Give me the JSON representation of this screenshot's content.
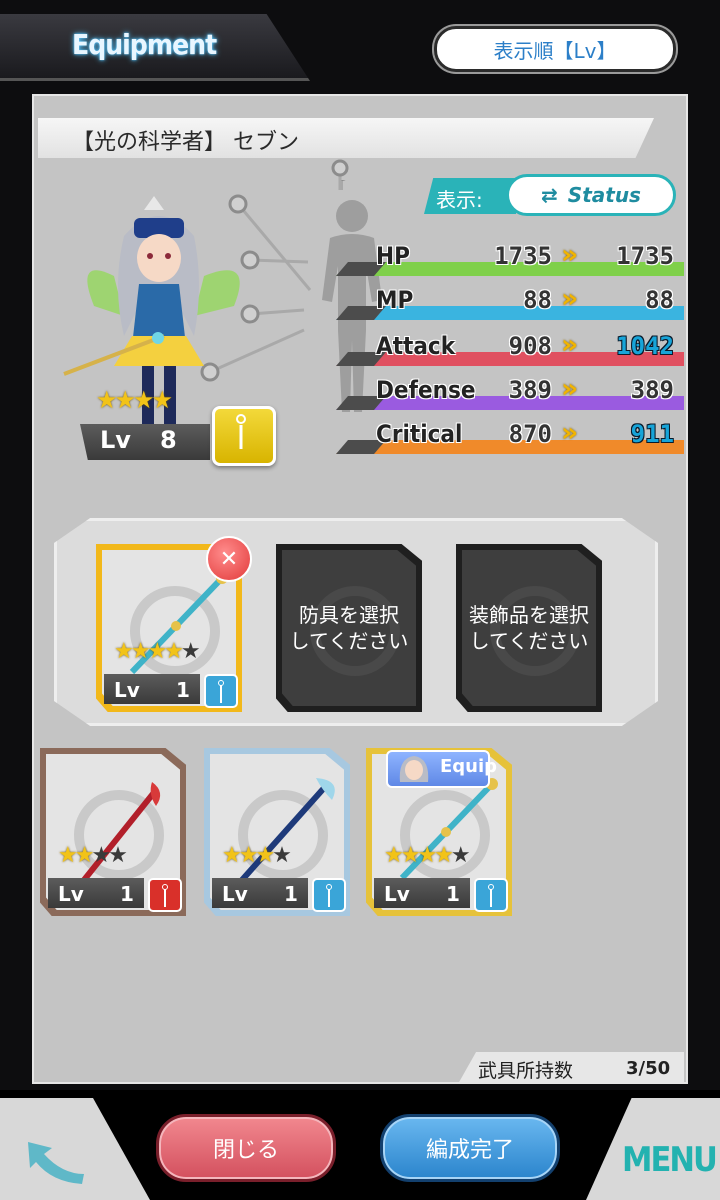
{
  "header": {
    "title": "Equipment",
    "sort_label": "表示順【Lv】"
  },
  "character": {
    "name": "【光の科学者】 セブン",
    "stars": "★★★★",
    "lv_label": "Lv",
    "lv_value": "8"
  },
  "stats_panel": {
    "display_label": "表示:",
    "toggle_label": "Status",
    "rows": [
      {
        "name": "HP",
        "current": "1735",
        "new": "1735",
        "color": "#7fd04a"
      },
      {
        "name": "MP",
        "current": "88",
        "new": "88",
        "color": "#3ab4e0"
      },
      {
        "name": "Attack",
        "current": "908",
        "new": "1042",
        "color": "#e05060"
      },
      {
        "name": "Defense",
        "current": "389",
        "new": "389",
        "color": "#9a5be0"
      },
      {
        "name": "Critical",
        "current": "870",
        "new": "911",
        "color": "#f08a2a"
      }
    ]
  },
  "equipped": {
    "weapon": {
      "stars_on": "★★★★",
      "stars_off": "★",
      "lv_label": "Lv",
      "lv": "1",
      "info_color": "#3aa5d8"
    },
    "armor_slot": "防具を選択\nしてください",
    "accessory_slot": "装飾品を選択\nしてください"
  },
  "inventory": [
    {
      "stars_on": "★★",
      "stars_off": "★★",
      "lv_label": "Lv",
      "lv": "1",
      "frame_color": "#8b6a5a",
      "info_color": "#d9302a"
    },
    {
      "stars_on": "★★★",
      "stars_off": "★",
      "lv_label": "Lv",
      "lv": "1",
      "frame_color": "#a7c8e0",
      "info_color": "#3aa5d8"
    },
    {
      "stars_on": "★★★★",
      "stars_off": "★",
      "lv_label": "Lv",
      "lv": "1",
      "frame_color": "#e6c23a",
      "info_color": "#3aa5d8",
      "badge": "Equip"
    }
  ],
  "footer": {
    "count_label": "武具所持数",
    "count_value": "3/50",
    "close_label": "閉じる",
    "confirm_label": "編成完了",
    "menu_label": "MENU"
  }
}
